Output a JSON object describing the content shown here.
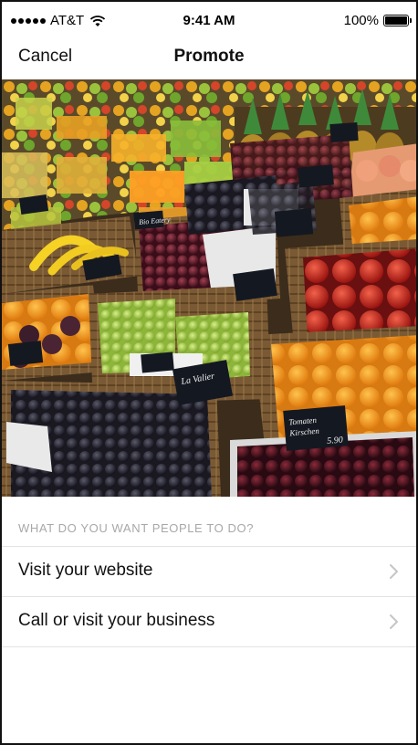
{
  "status_bar": {
    "carrier": "AT&T",
    "time": "9:41 AM",
    "battery": "100%"
  },
  "nav": {
    "cancel_label": "Cancel",
    "title": "Promote"
  },
  "photo": {
    "icon": "market-produce-photo",
    "sign_texts": [
      "Bio Eatery",
      "La Valier",
      "Tomaten Kirschen 5.90"
    ]
  },
  "prompt": {
    "heading": "WHAT DO YOU WANT PEOPLE TO DO?",
    "options": [
      {
        "label": "Visit your website"
      },
      {
        "label": "Call or visit your business"
      }
    ]
  },
  "colors": {
    "accent_text": "#111111",
    "muted_text": "#a8a8a8",
    "divider": "#e3e3e3"
  }
}
